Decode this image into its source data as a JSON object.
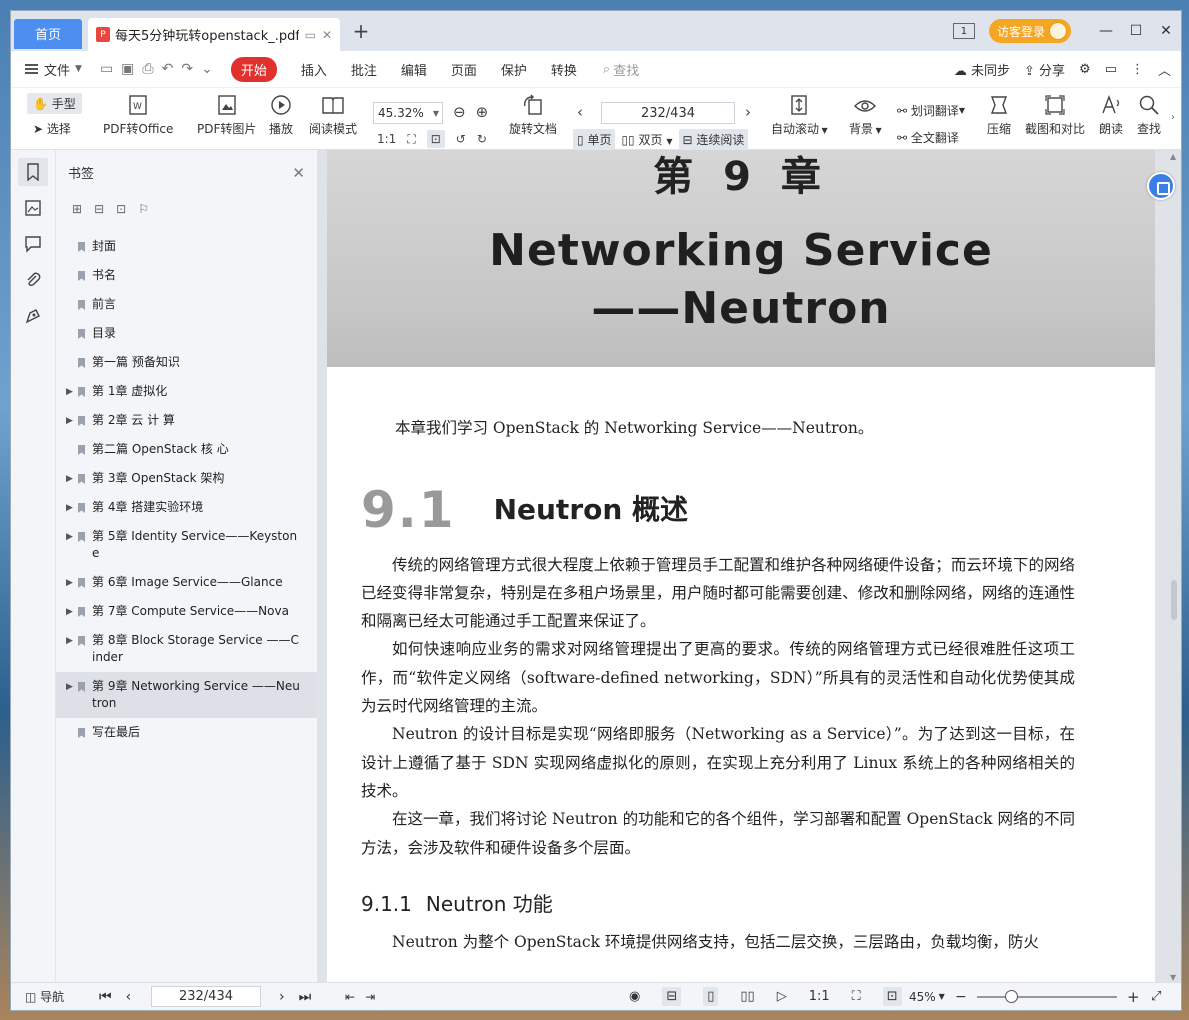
{
  "titlebar": {
    "home_tab": "首页",
    "doc_tab_title": "每天5分钟玩转openstack_.pdf",
    "new_tab": "+",
    "page_badge": "1",
    "login": "访客登录",
    "minimize": "—",
    "maximize": "☐",
    "close": "✕"
  },
  "menubar": {
    "file": "文件",
    "start": "开始",
    "items": [
      "插入",
      "批注",
      "编辑",
      "页面",
      "保护",
      "转换"
    ],
    "search": "查找",
    "sync": "未同步",
    "share": "分享"
  },
  "toolbar": {
    "hand": "手型",
    "select": "选择",
    "pdf_to_office": "PDF转Office",
    "pdf_to_image": "PDF转图片",
    "play": "播放",
    "read_mode": "阅读模式",
    "zoom": "45.32%",
    "rotate": "旋转文档",
    "page": "232/434",
    "single": "单页",
    "double": "双页",
    "continuous": "连续阅读",
    "auto_scroll": "自动滚动",
    "background": "背景",
    "word_translate": "划词翻译",
    "full_translate": "全文翻译",
    "compress": "压缩",
    "screenshot_compare": "截图和对比",
    "read_aloud": "朗读",
    "find": "查找"
  },
  "bookmarks": {
    "title": "书签",
    "items": [
      {
        "label": "封面",
        "expandable": false
      },
      {
        "label": "书名",
        "expandable": false
      },
      {
        "label": "前言",
        "expandable": false
      },
      {
        "label": "目录",
        "expandable": false
      },
      {
        "label": "第一篇 预备知识",
        "expandable": false
      },
      {
        "label": "第 1章 虚拟化",
        "expandable": true
      },
      {
        "label": "第 2章 云 计 算",
        "expandable": true
      },
      {
        "label": "第二篇 OpenStack 核 心",
        "expandable": false
      },
      {
        "label": "第 3章 OpenStack 架构",
        "expandable": true
      },
      {
        "label": "第 4章 搭建实验环境",
        "expandable": true
      },
      {
        "label": "第 5章 Identity Service——Keystone",
        "expandable": true
      },
      {
        "label": "第 6章 Image Service——Glance",
        "expandable": true
      },
      {
        "label": "第 7章 Compute Service——Nova",
        "expandable": true
      },
      {
        "label": "第 8章 Block Storage Service ——Cinder",
        "expandable": true
      },
      {
        "label": "第 9章 Networking Service ——Neutron",
        "expandable": true,
        "selected": true
      },
      {
        "label": "写在最后",
        "expandable": false
      }
    ]
  },
  "document": {
    "chapter": "第 9 章",
    "banner_line1": "Networking Service",
    "banner_line2": "——Neutron",
    "intro": "本章我们学习 OpenStack 的 Networking Service——Neutron。",
    "section_num": "9.1",
    "section_title": "Neutron 概述",
    "paragraphs": [
      "传统的网络管理方式很大程度上依赖于管理员手工配置和维护各种网络硬件设备；而云环境下的网络已经变得非常复杂，特别是在多租户场景里，用户随时都可能需要创建、修改和删除网络，网络的连通性和隔离已经太可能通过手工配置来保证了。",
      "如何快速响应业务的需求对网络管理提出了更高的要求。传统的网络管理方式已经很难胜任这项工作，而“软件定义网络（software-defined networking，SDN）”所具有的灵活性和自动化优势使其成为云时代网络管理的主流。",
      "Neutron 的设计目标是实现“网络即服务（Networking as a Service）”。为了达到这一目标，在设计上遵循了基于 SDN 实现网络虚拟化的原则，在实现上充分利用了 Linux 系统上的各种网络相关的技术。",
      "在这一章，我们将讨论 Neutron 的功能和它的各个组件，学习部署和配置 OpenStack 网络的不同方法，会涉及软件和硬件设备多个层面。"
    ],
    "subsection_num": "9.1.1",
    "subsection_title": "Neutron 功能",
    "last_line": "Neutron 为整个 OpenStack 环境提供网络支持，包括二层交换，三层路由，负载均衡，防火"
  },
  "statusbar": {
    "nav": "导航",
    "page": "232/434",
    "zoom": "45%"
  }
}
